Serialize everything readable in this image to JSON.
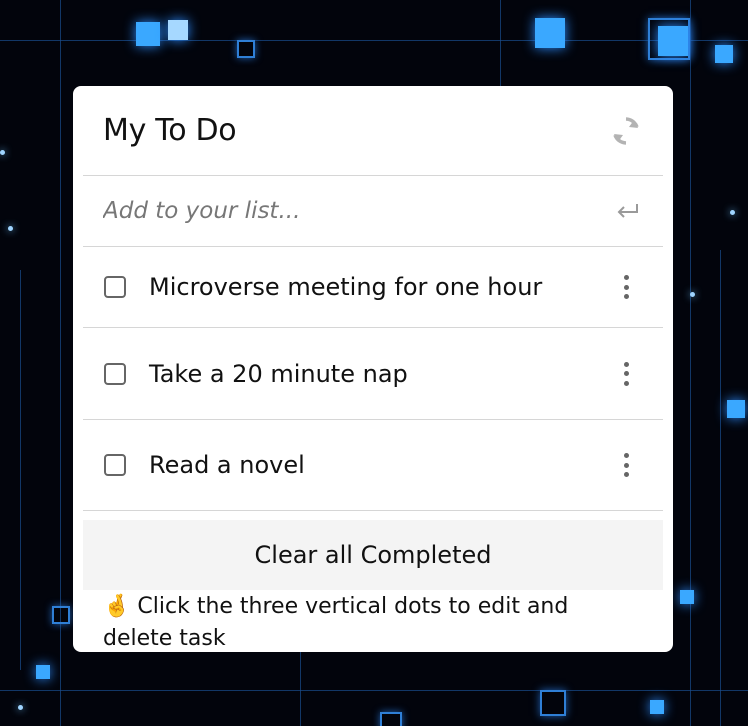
{
  "app": {
    "title": "My To Do",
    "refresh_icon": "refresh-icon",
    "add_placeholder": "Add to your list...",
    "enter_icon": "enter-icon"
  },
  "tasks": [
    {
      "label": "Microverse meeting for one hour",
      "completed": false
    },
    {
      "label": "Take a 20 minute nap",
      "completed": false
    },
    {
      "label": "Read a novel",
      "completed": false
    }
  ],
  "clear_label": "Clear all Completed",
  "hint": {
    "emoji": "🤞",
    "text": "Click the three vertical dots to edit and delete task"
  },
  "colors": {
    "card": "#ffffff",
    "divider": "#d6d6d6",
    "clear_button_bg": "#f4f4f4",
    "background": "#02040c",
    "accent_glow": "#3aa8ff"
  }
}
